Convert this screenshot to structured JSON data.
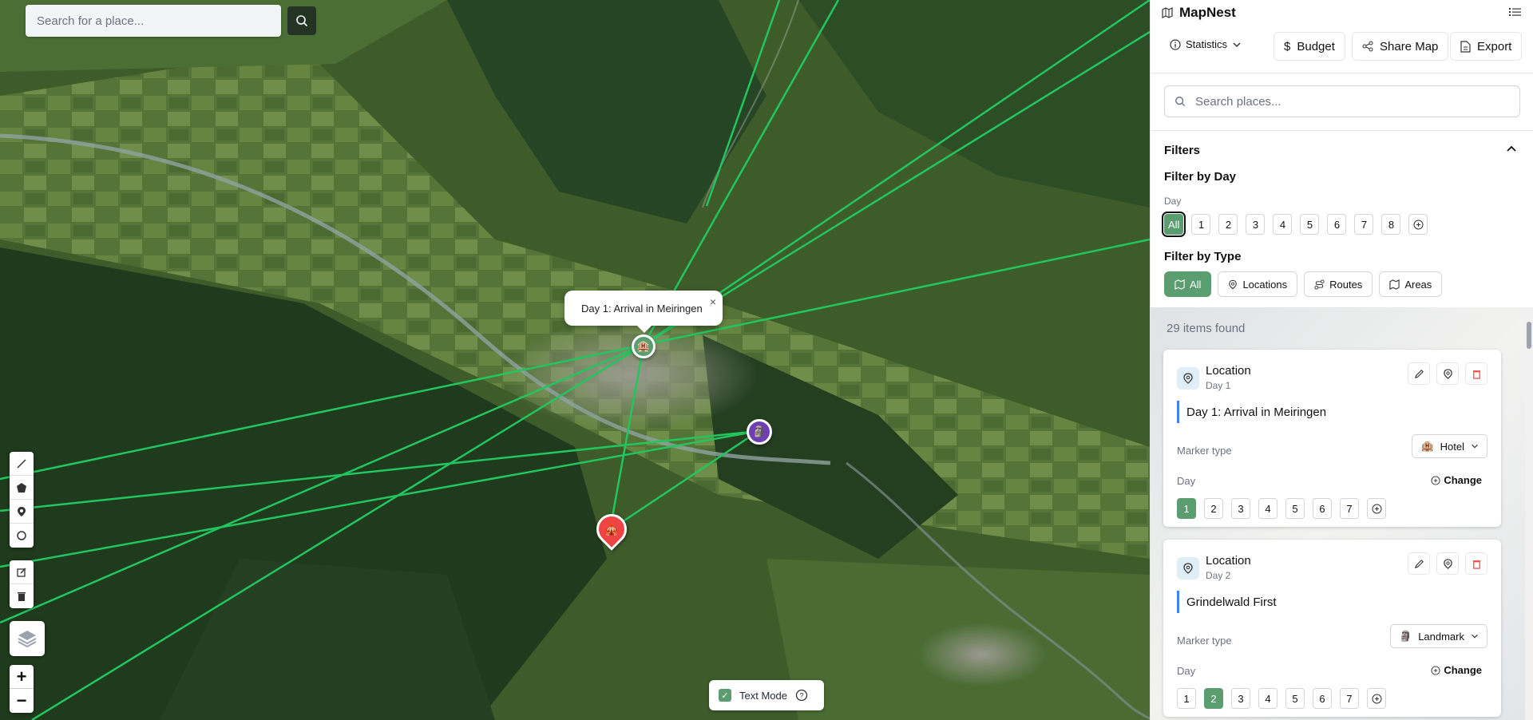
{
  "map": {
    "search_placeholder": "Search for a place...",
    "popup_title": "Day 1: Arrival in Meiringen",
    "popup_close": "×",
    "zoom_in": "+",
    "zoom_out": "−",
    "text_mode_label": "Text Mode",
    "route_color": "#22c55e",
    "markers": [
      {
        "name": "hotel-marker",
        "color": "#5a9e6f",
        "icon": "🏨"
      },
      {
        "name": "landmark-marker",
        "color": "#6d3fb0",
        "icon": "🗿"
      },
      {
        "name": "attraction-marker",
        "color": "#ef4444",
        "icon": "🎪"
      }
    ]
  },
  "app": {
    "title": "MapNest",
    "statistics_label": "Statistics",
    "budget_label": "Budget",
    "share_label": "Share Map",
    "export_label": "Export",
    "search_placeholder": "Search places...",
    "accent": "#5a9e6f"
  },
  "filters": {
    "title": "Filters",
    "by_day_title": "Filter by Day",
    "day_label": "Day",
    "days": [
      "All",
      "1",
      "2",
      "3",
      "4",
      "5",
      "6",
      "7",
      "8"
    ],
    "active_day": "All",
    "by_type_title": "Filter by Type",
    "types": [
      {
        "label": "All",
        "icon": "map-icon",
        "active": true
      },
      {
        "label": "Locations",
        "icon": "pin-icon",
        "active": false
      },
      {
        "label": "Routes",
        "icon": "route-icon",
        "active": false
      },
      {
        "label": "Areas",
        "icon": "map-icon",
        "active": false
      }
    ]
  },
  "list": {
    "count_text": "29 items found",
    "items": [
      {
        "type": "Location",
        "day": "Day 1",
        "name": "Day 1: Arrival in Meiringen",
        "marker_label": "Marker type",
        "marker_value": "Hotel",
        "marker_icon": "🏨",
        "day_label": "Day",
        "change_label": "Change",
        "days": [
          "1",
          "2",
          "3",
          "4",
          "5",
          "6",
          "7"
        ],
        "selected_day": "1"
      },
      {
        "type": "Location",
        "day": "Day 2",
        "name": "Grindelwald First",
        "marker_label": "Marker type",
        "marker_value": "Landmark",
        "marker_icon": "🗿",
        "day_label": "Day",
        "change_label": "Change",
        "days": [
          "1",
          "2",
          "3",
          "4",
          "5",
          "6",
          "7"
        ],
        "selected_day": "2"
      }
    ]
  }
}
